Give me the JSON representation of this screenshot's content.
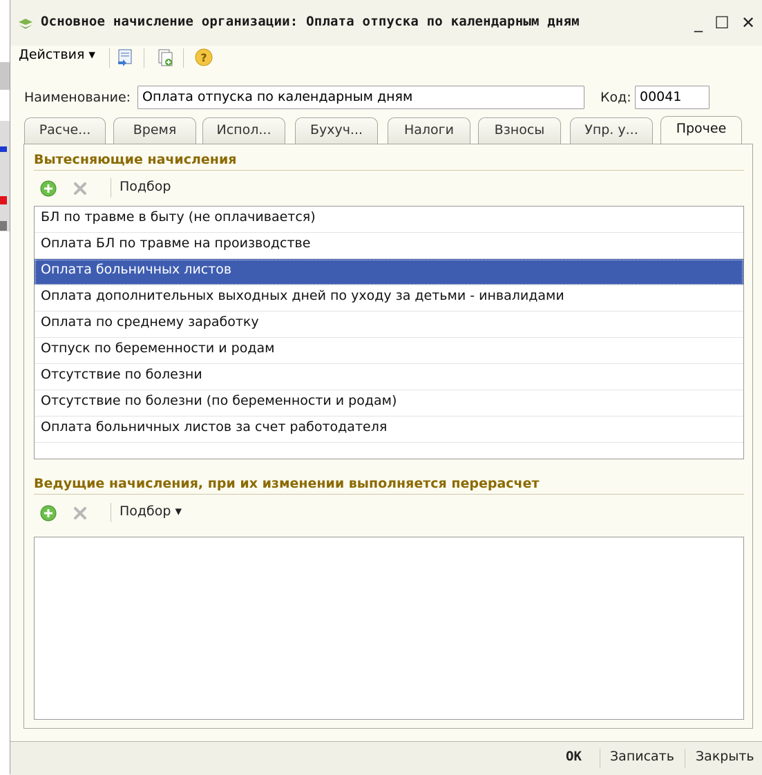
{
  "window": {
    "title": "Основное начисление организации: Оплата отпуска по календарным дням",
    "minimize": "_",
    "maximize": "☐",
    "close": "✕"
  },
  "toolbar": {
    "actions_label": "Действия ▾",
    "icons": [
      "copy-to-list-icon",
      "new-copy-icon",
      "help-icon"
    ]
  },
  "form": {
    "name_label": "Наименование:",
    "name_value": "Оплата отпуска по календарным дням",
    "code_label": "Код:",
    "code_value": "00041"
  },
  "tabs": [
    {
      "label": "Расче..."
    },
    {
      "label": "Время"
    },
    {
      "label": "Испол..."
    },
    {
      "label": "Бухуч..."
    },
    {
      "label": "Налоги"
    },
    {
      "label": "Взносы"
    },
    {
      "label": "Упр. у..."
    },
    {
      "label": "Прочее",
      "active": true
    }
  ],
  "displacing": {
    "title": "Вытесняющие начисления",
    "pick_label": "Подбор",
    "rows": [
      "БЛ по травме в быту (не оплачивается)",
      "Оплата БЛ по травме на производстве",
      "Оплата больничных листов",
      "Оплата дополнительных выходных дней по уходу за детьми - инвалидами",
      "Оплата по среднему заработку",
      "Отпуск по беременности и родам",
      "Отсутствие по болезни",
      "Отсутствие по болезни (по беременности и родам)",
      "Оплата больничных листов за счет работодателя"
    ],
    "selected_index": 2
  },
  "leading": {
    "title": "Ведущие начисления, при их изменении выполняется перерасчет",
    "pick_label": "Подбор ▾"
  },
  "footer": {
    "ok": "OK",
    "save": "Записать",
    "close": "Закрыть"
  },
  "colors": {
    "selection": "#3f5db0",
    "group_title": "#8b6a00",
    "window_bg": "#fbfbf1"
  }
}
